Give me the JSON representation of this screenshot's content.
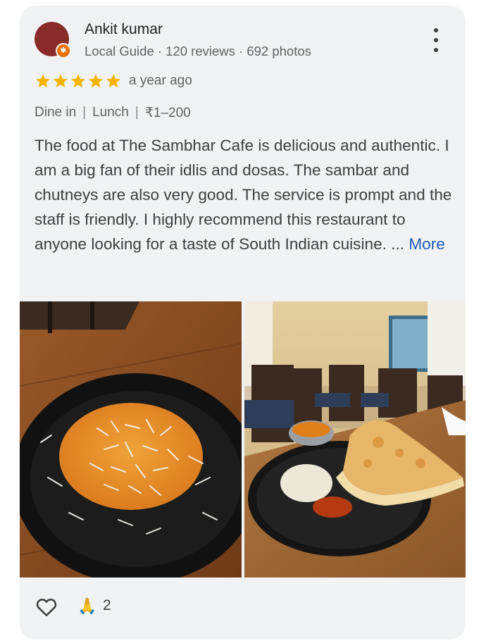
{
  "review": {
    "author": "Ankit kumar",
    "author_meta": "Local Guide · 120 reviews · 692 photos",
    "rating": 5,
    "time": "a year ago",
    "tags": [
      "Dine in",
      "Lunch",
      "₹1–200"
    ],
    "text": "The food at The Sambhar Cafe is delicious and authentic. I am a big fan of their idlis and dosas. The sambar and chutneys are also very good. The service is prompt and the staff is friendly. I highly recommend this restaurant to anyone looking for a taste of South Indian cuisine. ...",
    "more_label": "More",
    "reaction_count": "2",
    "icons": {
      "avatar": "avatar",
      "guide_badge": "local-guide-badge-icon",
      "menu": "more-vert-icon",
      "star": "star-icon",
      "like": "heart-outline-icon",
      "reaction": "folded-hands-icon"
    },
    "colors": {
      "star": "#f4b400",
      "link": "#1a5bb8",
      "avatar": "#8a2b2b",
      "badge": "#e8710a"
    }
  }
}
